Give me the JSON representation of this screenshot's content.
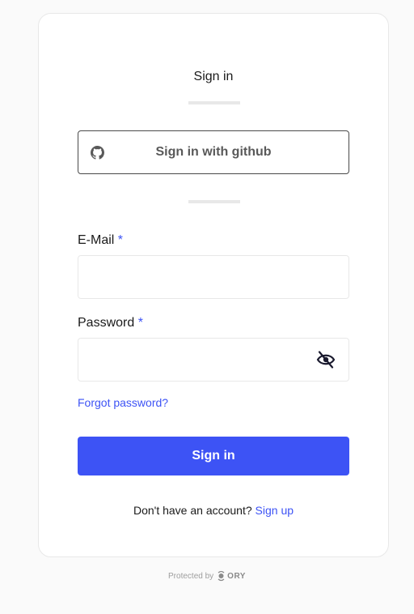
{
  "card": {
    "title": "Sign in",
    "oidc_button": {
      "label": "Sign in with github",
      "icon": "github-icon"
    },
    "email": {
      "label": "E-Mail",
      "required_mark": "*",
      "value": "",
      "placeholder": ""
    },
    "password": {
      "label": "Password",
      "required_mark": "*",
      "value": "",
      "placeholder": "",
      "toggle_icon": "eye-off-icon"
    },
    "forgot_link": "Forgot password?",
    "submit_label": "Sign in",
    "signup_prompt": "Don't have an account?",
    "signup_link": "Sign up"
  },
  "footer": {
    "protected_by": "Protected by",
    "brand": "ORY"
  },
  "colors": {
    "accent": "#3d53f5",
    "background": "#fafafa",
    "card": "#ffffff",
    "border": "#e8e8e8"
  }
}
